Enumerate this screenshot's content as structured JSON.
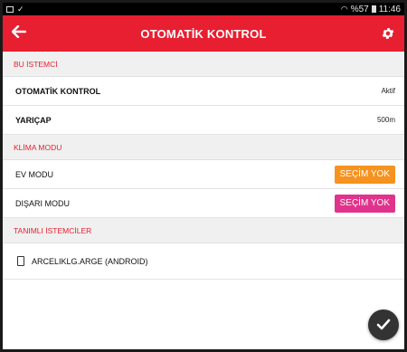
{
  "statusbar": {
    "left_icons": [
      "image-icon",
      "check-icon"
    ],
    "wifi": "wifi-icon",
    "battery_text": "%57",
    "time": "11:46"
  },
  "appbar": {
    "title": "OTOMATİK KONTROL",
    "back_icon": "arrow-left-icon",
    "settings_icon": "gear-icon",
    "background_color": "#e71f30"
  },
  "sections": {
    "client": {
      "header": "BU İSTEMCİ",
      "auto_control_label": "OTOMATİK KONTROL",
      "auto_control_value": "Aktif",
      "radius_label": "YARIÇAP",
      "radius_value": "500m"
    },
    "ac_mode": {
      "header": "KLİMA MODU",
      "home_mode_label": "EV MODU",
      "home_mode_button": "SEÇİM YOK",
      "away_mode_label": "DIŞARI MODU",
      "away_mode_button": "SEÇİM YOK"
    },
    "clients": {
      "header": "TANIMLI İSTEMCİLER",
      "items": [
        {
          "name": "ARCELIKLG.ARGE (ANDROID)",
          "icon": "phone-icon"
        }
      ]
    }
  },
  "fab": {
    "icon": "checkmark-icon"
  },
  "colors": {
    "accent": "#e71f30",
    "orange": "#f6921e",
    "pink": "#e0338c"
  }
}
